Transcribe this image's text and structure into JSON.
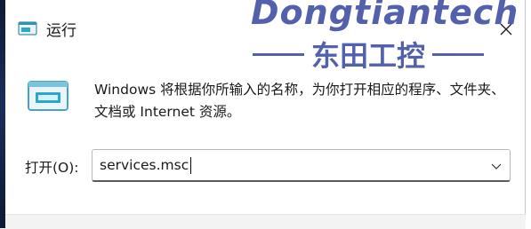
{
  "window": {
    "title": "运行",
    "close_icon": "close-icon",
    "title_icon": "run-app-icon"
  },
  "watermark": {
    "brand": "Dongtiantech",
    "cn": "东田工控"
  },
  "body": {
    "icon": "run-dialog-icon",
    "description": "Windows 将根据你所输入的名称，为你打开相应的程序、文件夹、文档或 Internet 资源。",
    "open_label": "打开(O):",
    "input_value": "services.msc",
    "dropdown_icon": "chevron-down-icon"
  },
  "colors": {
    "watermark": "#2e3f9c",
    "icon_accent": "#2aa7c9"
  }
}
